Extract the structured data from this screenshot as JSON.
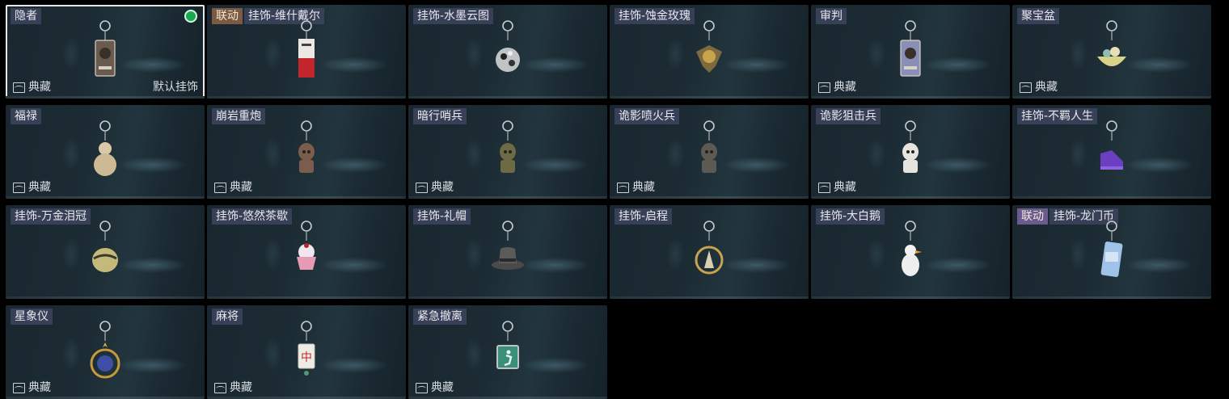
{
  "default_charm_label": "默认挂饰",
  "collection_label": "典藏",
  "items": [
    {
      "name": "隐者",
      "icon": "tarot-card-charm-icon",
      "collection": true,
      "default": true,
      "equipped": true,
      "selected": true
    },
    {
      "collab_tag": "联动",
      "collab_color": "#7a5a42",
      "name": "挂饰-维什戴尔",
      "icon": "red-tag-charm-icon",
      "collection": false
    },
    {
      "name": "挂饰-水墨云图",
      "icon": "disco-ball-charm-icon",
      "collection": false
    },
    {
      "name": "挂饰-蚀金玫瑰",
      "icon": "golden-rose-charm-icon",
      "collection": false
    },
    {
      "name": "审判",
      "icon": "judgement-card-charm-icon",
      "collection": true
    },
    {
      "name": "聚宝盆",
      "icon": "treasure-bowl-charm-icon",
      "collection": true
    },
    {
      "name": "福禄",
      "icon": "gourd-charm-icon",
      "collection": true
    },
    {
      "name": "崩岩重炮",
      "icon": "heavy-gunner-charm-icon",
      "collection": true
    },
    {
      "name": "暗行哨兵",
      "icon": "sentinel-charm-icon",
      "collection": true
    },
    {
      "name": "诡影喷火兵",
      "icon": "flamethrower-charm-icon",
      "collection": true
    },
    {
      "name": "诡影狙击兵",
      "icon": "sniper-charm-icon",
      "collection": true
    },
    {
      "name": "挂饰-不羁人生",
      "icon": "sneaker-charm-icon",
      "collection": false
    },
    {
      "name": "挂饰-万金泪冠",
      "icon": "crown-charm-icon",
      "collection": false
    },
    {
      "name": "挂饰-悠然茶歇",
      "icon": "cupcake-charm-icon",
      "collection": false
    },
    {
      "name": "挂饰-礼帽",
      "icon": "top-hat-charm-icon",
      "collection": false
    },
    {
      "name": "挂饰-启程",
      "icon": "compass-medal-charm-icon",
      "collection": false
    },
    {
      "name": "挂饰-大白鹅",
      "icon": "goose-charm-icon",
      "collection": false
    },
    {
      "collab_tag": "联动",
      "collab_color": "#6a5a8e",
      "name": "挂饰-龙门币",
      "icon": "coin-card-charm-icon",
      "collection": false
    },
    {
      "name": "星象仪",
      "icon": "orrery-charm-icon",
      "collection": true
    },
    {
      "name": "麻将",
      "icon": "mahjong-tile-charm-icon",
      "collection": true
    },
    {
      "name": "紧急撤离",
      "icon": "exit-sign-charm-icon",
      "collection": true
    }
  ]
}
